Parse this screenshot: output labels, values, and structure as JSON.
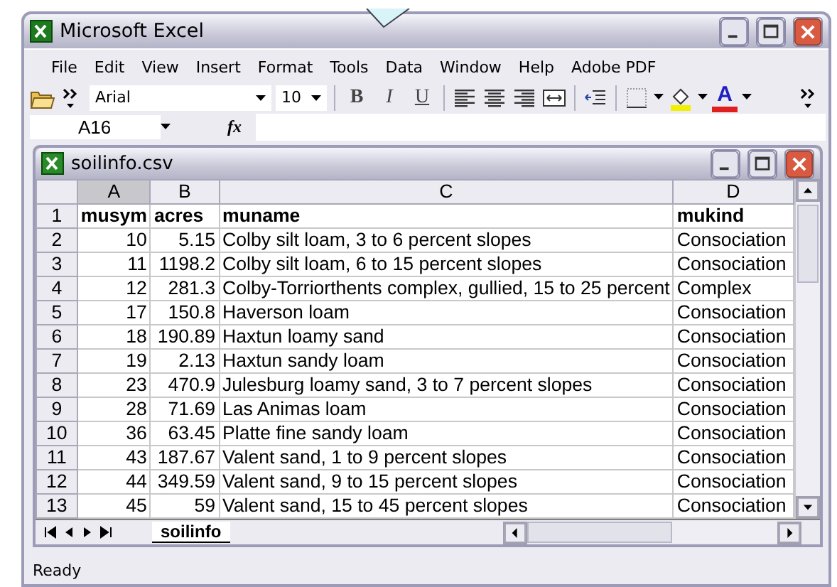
{
  "window": {
    "title": "Microsoft Excel"
  },
  "menu": [
    "File",
    "Edit",
    "View",
    "Insert",
    "Format",
    "Tools",
    "Data",
    "Window",
    "Help",
    "Adobe PDF"
  ],
  "toolbar": {
    "font": "Arial",
    "size": "10",
    "format_buttons": [
      {
        "label": "B",
        "kind": "bold"
      },
      {
        "label": "I",
        "kind": "italic"
      },
      {
        "label": "U",
        "kind": "underline"
      }
    ],
    "font_color_label": "A"
  },
  "formula_bar": {
    "name_box": "A16",
    "function_label": "fx"
  },
  "workbook": {
    "title": "soilinfo.csv",
    "columns": [
      {
        "label": "A",
        "selected": true
      },
      {
        "label": "B",
        "selected": false
      },
      {
        "label": "C",
        "selected": false
      },
      {
        "label": "D",
        "selected": false
      }
    ],
    "rows": [
      {
        "number": "1",
        "kind": "header",
        "cells": [
          "musym",
          "acres",
          "muname",
          "mukind"
        ]
      },
      {
        "number": "2",
        "kind": "data",
        "cells": [
          "10",
          "5.15",
          "Colby silt loam, 3 to 6 percent slopes",
          "Consociation"
        ]
      },
      {
        "number": "3",
        "kind": "data",
        "cells": [
          "11",
          "1198.2",
          "Colby silt loam, 6 to 15 percent slopes",
          "Consociation"
        ]
      },
      {
        "number": "4",
        "kind": "data",
        "cells": [
          "12",
          "281.3",
          "Colby-Torriorthents complex, gullied, 15 to 25 percent",
          "Complex"
        ]
      },
      {
        "number": "5",
        "kind": "data",
        "cells": [
          "17",
          "150.8",
          "Haverson loam",
          "Consociation"
        ]
      },
      {
        "number": "6",
        "kind": "data",
        "cells": [
          "18",
          "190.89",
          "Haxtun loamy sand",
          "Consociation"
        ]
      },
      {
        "number": "7",
        "kind": "data",
        "cells": [
          "19",
          "2.13",
          "Haxtun sandy loam",
          "Consociation"
        ]
      },
      {
        "number": "8",
        "kind": "data",
        "cells": [
          "23",
          "470.9",
          "Julesburg loamy sand, 3 to 7 percent slopes",
          "Consociation"
        ]
      },
      {
        "number": "9",
        "kind": "data",
        "cells": [
          "28",
          "71.69",
          "Las Animas loam",
          "Consociation"
        ]
      },
      {
        "number": "10",
        "kind": "data",
        "cells": [
          "36",
          "63.45",
          "Platte fine sandy loam",
          "Consociation"
        ]
      },
      {
        "number": "11",
        "kind": "data",
        "cells": [
          "43",
          "187.67",
          "Valent sand, 1 to 9 percent slopes",
          "Consociation"
        ]
      },
      {
        "number": "12",
        "kind": "data",
        "cells": [
          "44",
          "349.59",
          "Valent sand, 9 to 15 percent slopes",
          "Consociation"
        ]
      },
      {
        "number": "13",
        "kind": "data",
        "cells": [
          "45",
          "59",
          "Valent sand, 15 to 45 percent slopes",
          "Consociation"
        ]
      }
    ],
    "sheet_tabs": [
      {
        "label": "soilinfo",
        "selected": true
      }
    ]
  },
  "status_bar": {
    "text": "Ready"
  }
}
